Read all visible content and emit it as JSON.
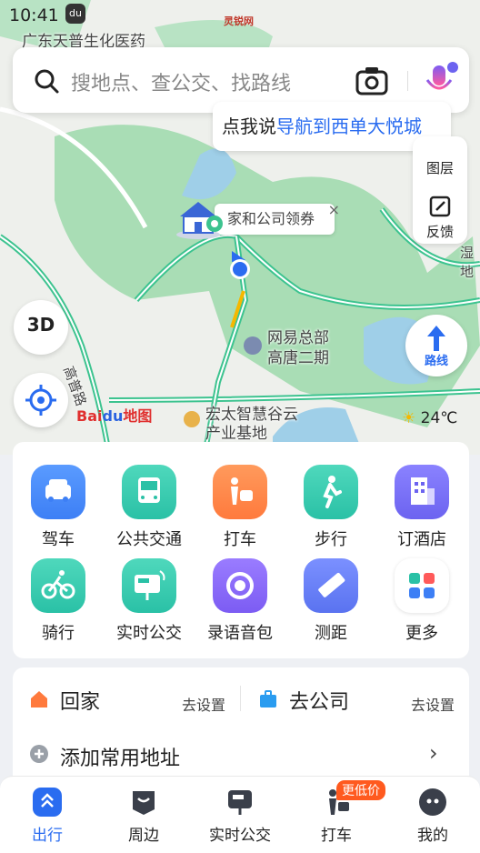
{
  "status_bar": {
    "time": "10:41",
    "app_icon_text": "du",
    "overlay_text": "灵锐网"
  },
  "search": {
    "placeholder": "搜地点、查公交、找路线"
  },
  "voice_tip": {
    "prefix": "点我说",
    "highlight": "导航到西单大悦城"
  },
  "map_tools": {
    "layers_label": "图层",
    "feedback_label": "反馈"
  },
  "map": {
    "labels": [
      {
        "text": "广东天普生化医药",
        "key": "poi-tianpu"
      },
      {
        "text": "网易总部",
        "key": "poi-netease-1"
      },
      {
        "text": "高唐二期",
        "key": "poi-netease-2"
      },
      {
        "text": "宏太智慧谷云",
        "key": "poi-hongtai-1"
      },
      {
        "text": "产业基地",
        "key": "poi-hongtai-2"
      },
      {
        "text": "高普路",
        "key": "road-gaopu"
      },
      {
        "text": "湿地",
        "key": "poi-wetland"
      }
    ],
    "home_bubble": "家和公司领券",
    "home_close": "×",
    "btn_3d": "3D",
    "route_label": "路线",
    "weather": "24℃",
    "logo_text": "Bai",
    "logo_paw": "du",
    "logo_suffix": "地图"
  },
  "grid": {
    "items": [
      {
        "label": "驾车",
        "color": "#3d7ff5",
        "icon": "car-icon"
      },
      {
        "label": "公共交通",
        "color": "#2ac1a6",
        "icon": "bus-icon"
      },
      {
        "label": "打车",
        "color": "#ff7a3d",
        "icon": "taxi-icon"
      },
      {
        "label": "步行",
        "color": "#2ac1a6",
        "icon": "walk-icon"
      },
      {
        "label": "订酒店",
        "color": "#6c63f0",
        "icon": "hotel-icon"
      },
      {
        "label": "骑行",
        "color": "#2ac1a6",
        "icon": "bike-icon"
      },
      {
        "label": "实时公交",
        "color": "#2ac1a6",
        "icon": "realtime-bus-icon"
      },
      {
        "label": "录语音包",
        "color": "#7c5cf3",
        "icon": "voice-pack-icon"
      },
      {
        "label": "测距",
        "color": "#5a73f0",
        "icon": "ruler-icon"
      },
      {
        "label": "更多",
        "color": "#ffffff",
        "icon": "more-icon"
      }
    ]
  },
  "addresses": {
    "home_label": "回家",
    "home_action": "去设置",
    "company_label": "去公司",
    "company_action": "去设置",
    "add_label": "添加常用地址",
    "add_chevron": "›"
  },
  "tabbar": {
    "tabs": [
      {
        "label": "出行",
        "active": true
      },
      {
        "label": "周边",
        "active": false
      },
      {
        "label": "实时公交",
        "active": false
      },
      {
        "label": "打车",
        "active": false
      },
      {
        "label": "我的",
        "active": false
      }
    ],
    "taxi_badge": "更低价"
  },
  "colors": {
    "accent": "#2a6cf0",
    "map_green": "#a9ddb5",
    "road": "#3cc38f"
  }
}
